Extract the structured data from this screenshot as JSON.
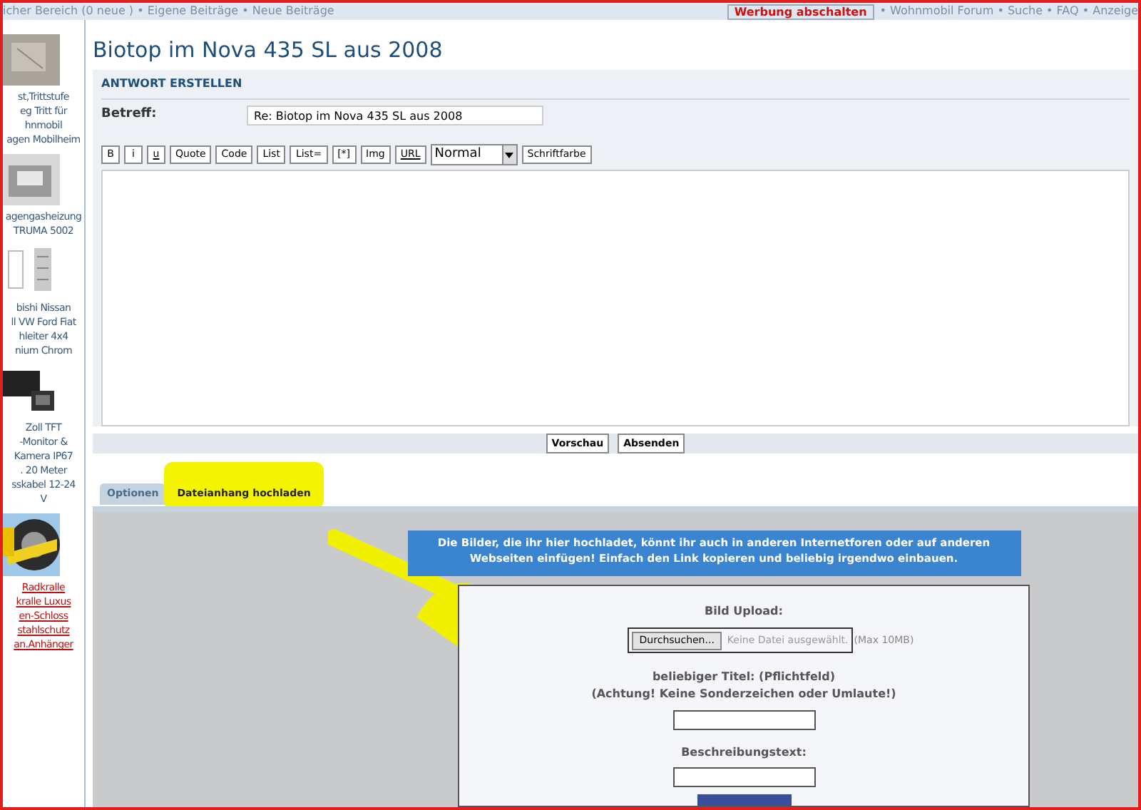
{
  "top_bar": {
    "links_text": "icher Bereich (0 neue ) • Eigene Beiträge • Neue Beiträge",
    "ad_button": "Werbung abschalten",
    "nav_text": "• Wohnmobil Forum • Suche • FAQ • Anzeige"
  },
  "sidebar": {
    "items": [
      {
        "kind": "picture",
        "lines": [
          "st,Trittstufe",
          "eg Tritt für",
          "hnmobil",
          "agen Mobilheim"
        ],
        "link": false
      },
      {
        "kind": "picture",
        "lines": [
          "agengasheizung",
          "TRUMA 5002"
        ],
        "link": false
      },
      {
        "kind": "picture",
        "lines": [
          "bishi Nissan",
          "ll VW Ford Fiat",
          "hleiter 4x4",
          "nium Chrom"
        ],
        "link": false
      },
      {
        "kind": "picture",
        "lines": [
          "Zoll TFT",
          "-Monitor &",
          "Kamera IP67",
          ". 20 Meter",
          "sskabel 12-24",
          "V"
        ],
        "link": false
      },
      {
        "kind": "picture",
        "lines": [
          "Radkralle",
          "kralle Luxus",
          "en-Schloss",
          "stahlschutz",
          "an.Anhänger"
        ],
        "link": true
      }
    ]
  },
  "title": "Biotop im Nova 435 SL aus 2008",
  "reply": {
    "heading": "ANTWORT ERSTELLEN",
    "subject_label": "Betreff:",
    "subject_value": "Re: Biotop im Nova 435 SL aus 2008",
    "toolbar": [
      "B",
      "i",
      "u",
      "Quote",
      "Code",
      "List",
      "List=",
      "[*]",
      "Img",
      "URL"
    ],
    "size_select": "Normal",
    "color_button": "Schriftfarbe",
    "buttons": [
      "Vorschau",
      "Absenden"
    ]
  },
  "tabs": [
    {
      "label": "Optionen",
      "selected": false
    },
    {
      "label": "Dateianhang hochladen",
      "selected": true
    }
  ],
  "upload": {
    "banner": "Die Bilder, die ihr hier hochladet, könnt ihr auch in anderen Internetforen oder auf anderen Webseiten einfügen! Einfach den Link kopieren und beliebig irgendwo einbauen.",
    "image_label": "Bild Upload:",
    "browse_button": "Durchsuchen...",
    "no_file": "Keine Datei ausgewählt.",
    "max_size": "(Max 10MB)",
    "title_label": "beliebiger Titel: (Pflichtfeld)",
    "title_hint": "(Achtung! Keine Sonderzeichen oder Umlaute!)",
    "description_label": "Beschreibungstext:"
  }
}
